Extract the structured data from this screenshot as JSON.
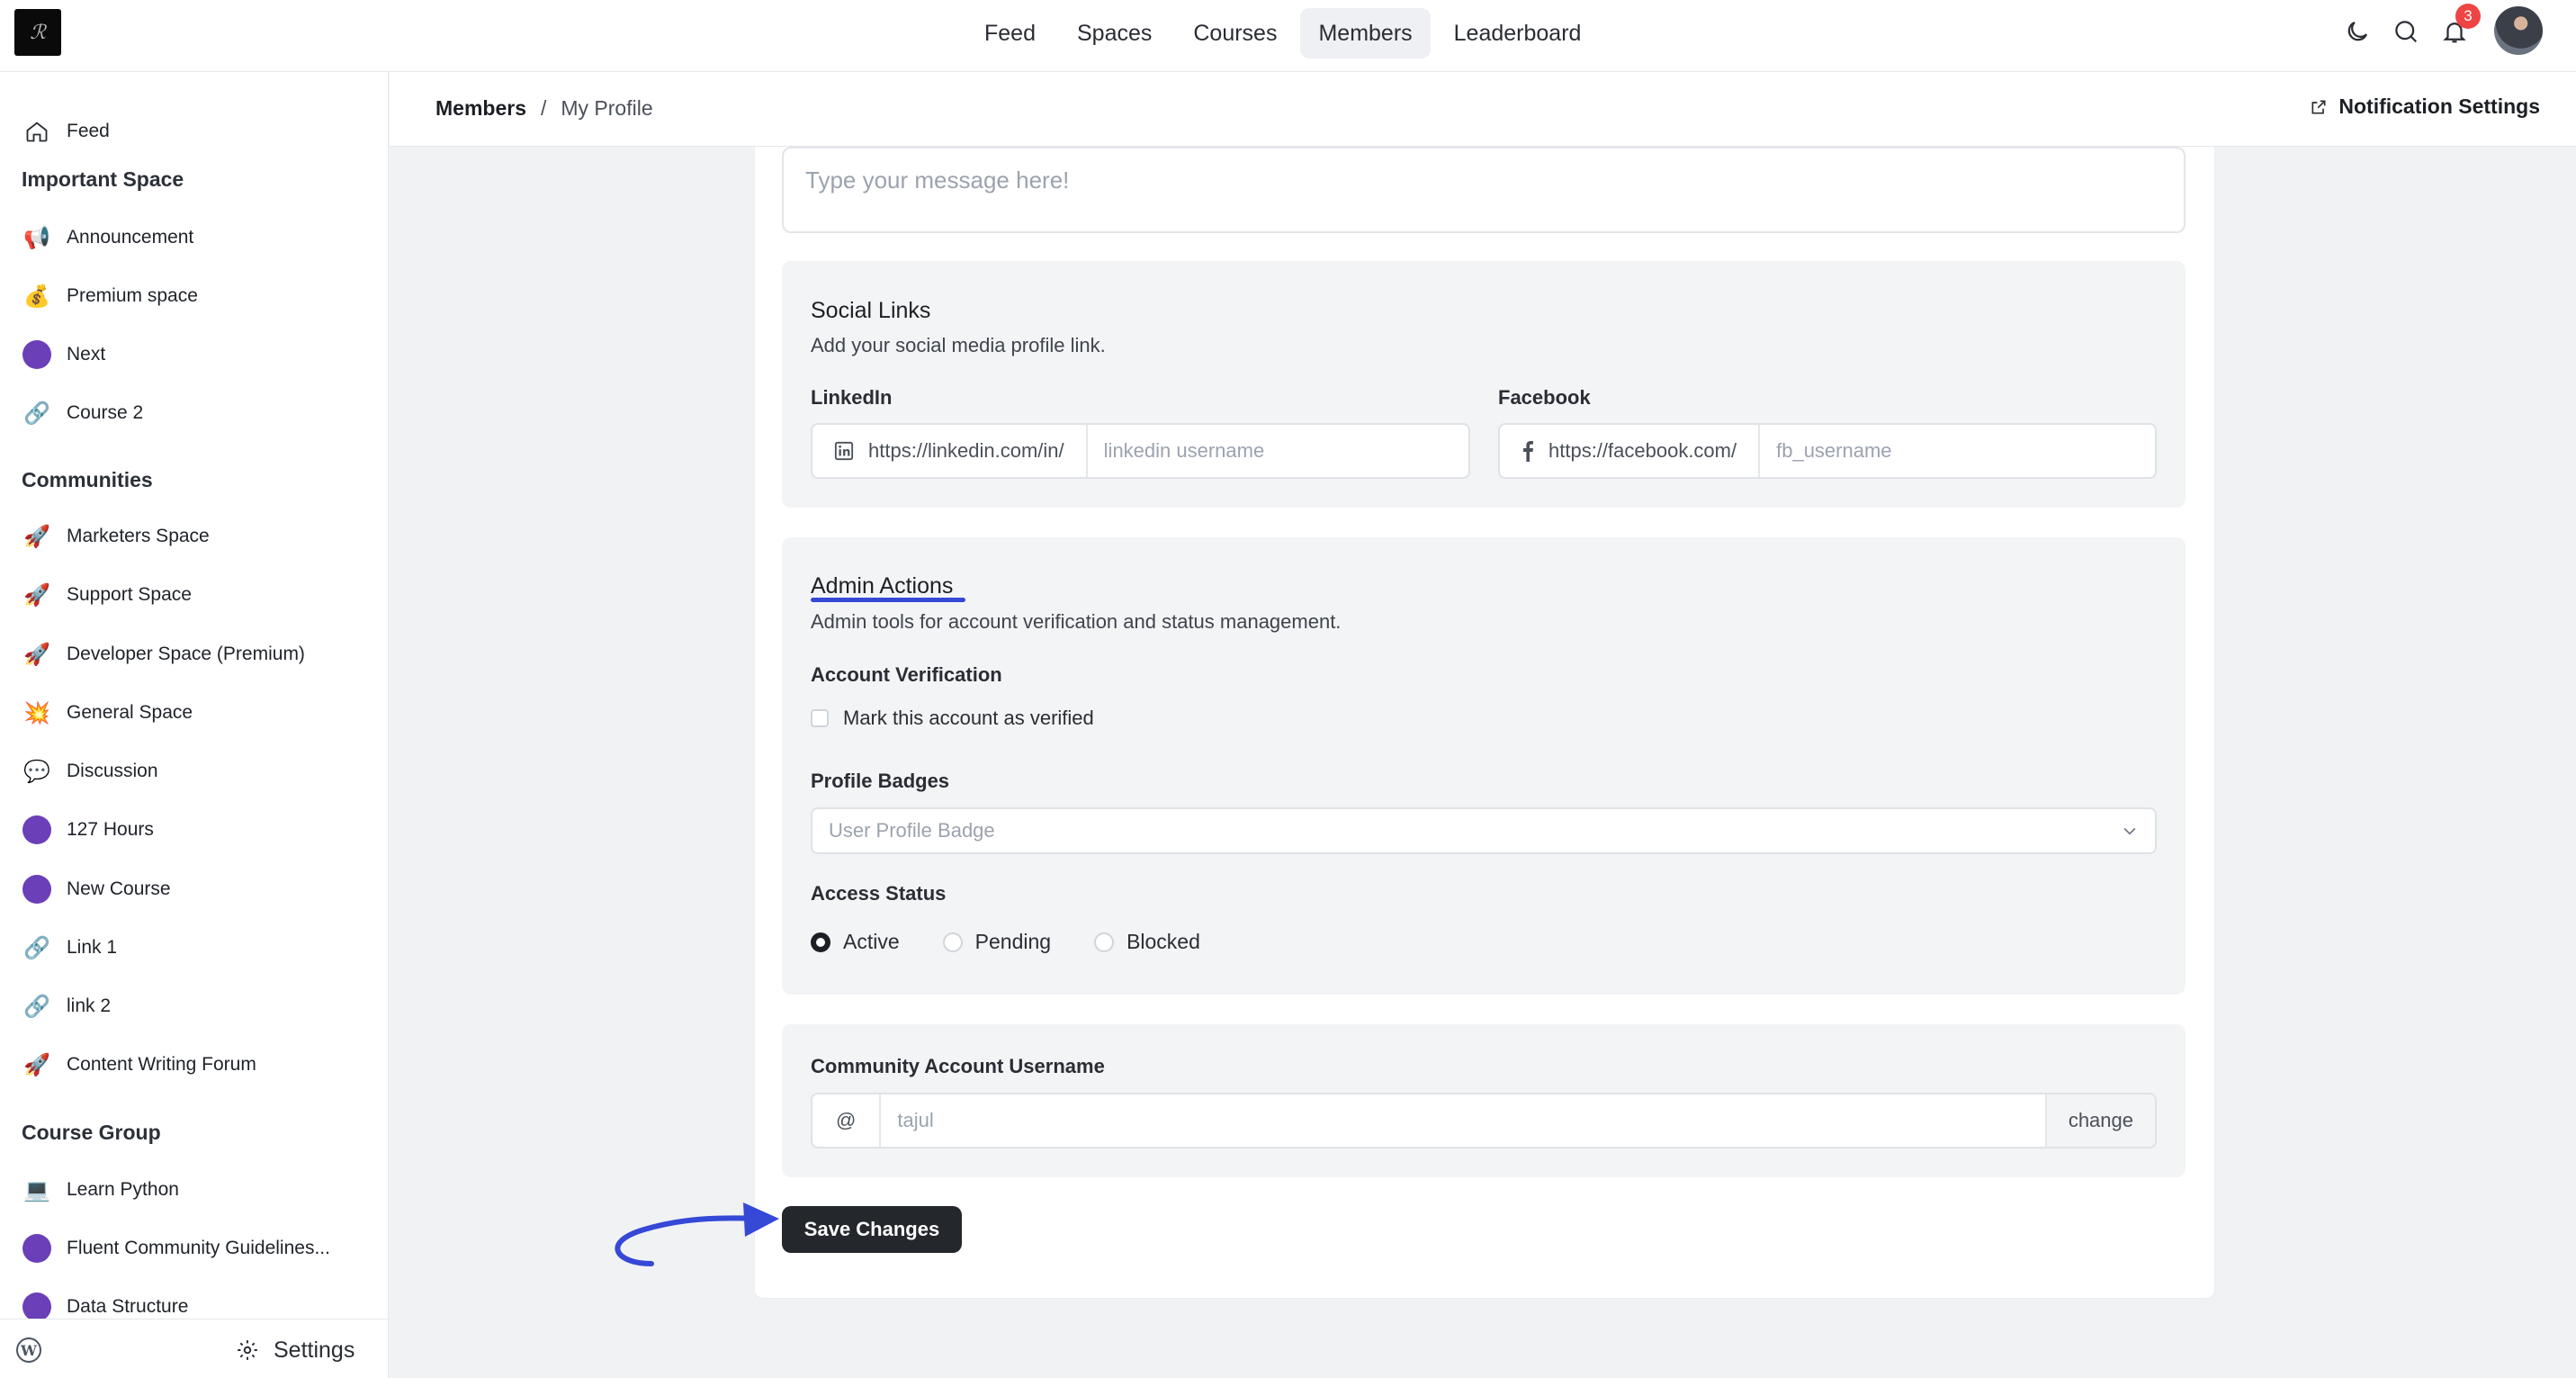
{
  "topnav": {
    "items": [
      "Feed",
      "Spaces",
      "Courses",
      "Members",
      "Leaderboard"
    ],
    "active": "Members",
    "notification_count": "3"
  },
  "sidebar": {
    "feed": "Feed",
    "sections": [
      {
        "title": "Important Space",
        "items": [
          "Announcement",
          "Premium space",
          "Next",
          "Course 2"
        ]
      },
      {
        "title": "Communities",
        "items": [
          "Marketers Space",
          "Support Space",
          "Developer Space (Premium)",
          "General Space",
          "Discussion",
          "127 Hours",
          "New Course",
          "Link 1",
          "link 2",
          "Content Writing Forum"
        ]
      },
      {
        "title": "Course Group",
        "items": [
          "Learn Python",
          "Fluent Community Guidelines...",
          "Data Structure"
        ]
      }
    ],
    "settings": "Settings"
  },
  "breadcrumb": {
    "root": "Members",
    "separator": "/",
    "current": "My Profile"
  },
  "notification_settings": "Notification Settings",
  "message": {
    "placeholder": "Type your message here!"
  },
  "social": {
    "title": "Social Links",
    "desc": "Add your social media profile link.",
    "linkedin": {
      "label": "LinkedIn",
      "prefix": "https://linkedin.com/in/",
      "placeholder": "linkedin username"
    },
    "facebook": {
      "label": "Facebook",
      "prefix": "https://facebook.com/",
      "placeholder": "fb_username"
    }
  },
  "admin": {
    "title": "Admin Actions",
    "desc": "Admin tools for account verification and status management.",
    "verification_label": "Account Verification",
    "verify_text": "Mark this account as verified",
    "badges_label": "Profile Badges",
    "badges_placeholder": "User Profile Badge",
    "status_label": "Access Status",
    "status_options": [
      "Active",
      "Pending",
      "Blocked"
    ],
    "status_selected": "Active"
  },
  "username": {
    "label": "Community Account Username",
    "prefix": "@",
    "placeholder": "tajul",
    "change": "change"
  },
  "save": "Save Changes",
  "colors": {
    "accent": "#3548d6",
    "space_dot": "#6b3fb8",
    "button": "#24272c",
    "badge": "#ef4444"
  }
}
